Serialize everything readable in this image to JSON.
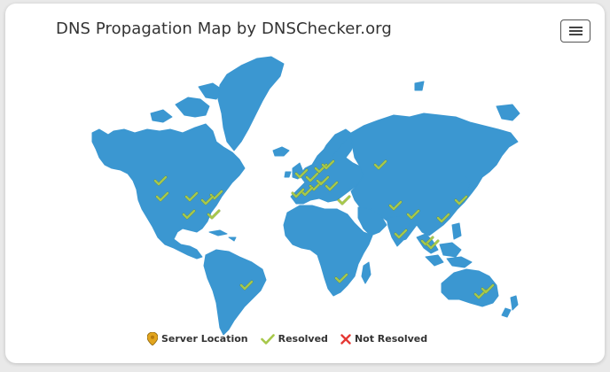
{
  "header": {
    "title": "DNS Propagation Map by DNSChecker.org"
  },
  "menu": {
    "icon": "hamburger-icon"
  },
  "legend": {
    "items": [
      {
        "label": "Server Location",
        "icon": "map-pin-icon",
        "color": "#e2a51e"
      },
      {
        "label": "Resolved",
        "icon": "checkmark-icon",
        "color": "#a7c84a"
      },
      {
        "label": "Not Resolved",
        "icon": "cross-icon",
        "color": "#e53935"
      }
    ]
  },
  "colors": {
    "land": "#3b97d1",
    "background": "#ffffff"
  }
}
